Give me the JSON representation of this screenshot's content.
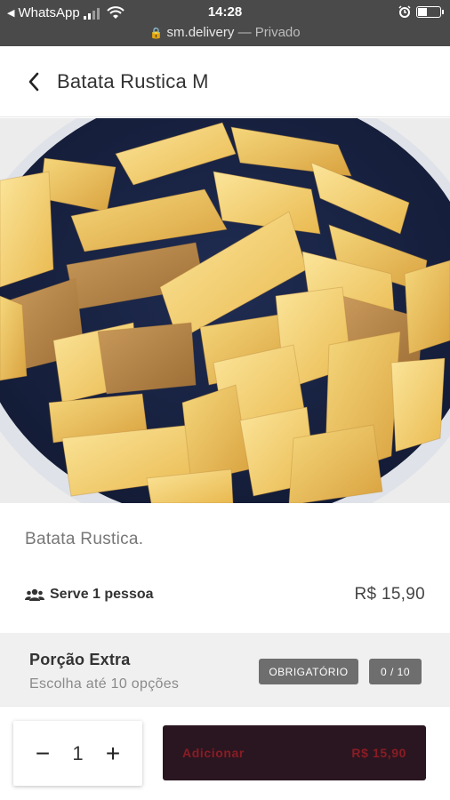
{
  "status_bar": {
    "back_app": "WhatsApp",
    "time": "14:28",
    "url": "sm.delivery",
    "separator": "—",
    "privacy": "Privado"
  },
  "header": {
    "title": "Batata Rustica M"
  },
  "product": {
    "image_icon": "fries-image",
    "description": "Batata Rustica.",
    "serves": "Serve 1 pessoa",
    "price": "R$ 15,90"
  },
  "extra": {
    "title": "Porção Extra",
    "subtitle": "Escolha até 10 opções",
    "required_badge": "OBRIGATÓRIO",
    "count_badge": "0 / 10"
  },
  "cart": {
    "decrement": "−",
    "quantity": "1",
    "increment": "+",
    "add_label": "Adicionar",
    "add_price": "R$ 15,90"
  },
  "colors": {
    "status_bar_bg": "#4a4a4a",
    "add_button_bg": "#2a1620",
    "add_button_text": "#8a1c24",
    "badge_bg": "#6e6e6e"
  }
}
